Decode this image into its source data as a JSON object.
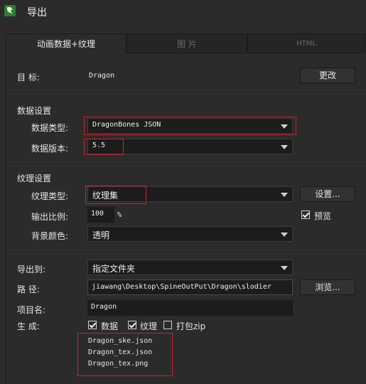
{
  "window": {
    "title": "导出"
  },
  "tabs": [
    {
      "label": "动画数据+纹理"
    },
    {
      "label": "图 片"
    },
    {
      "label": "HTML"
    }
  ],
  "target": {
    "label": "目 标:",
    "value": "Dragon",
    "change_button": "更改"
  },
  "data_settings": {
    "section_title": "数据设置",
    "type_label": "数据类型:",
    "type_value": "DragonBones JSON",
    "version_label": "数据版本:",
    "version_value": "5.5"
  },
  "texture_settings": {
    "section_title": "纹理设置",
    "type_label": "纹理类型:",
    "type_value": "纹理集",
    "settings_button": "设置...",
    "scale_label": "输出比例:",
    "scale_value": "100",
    "scale_unit": "%",
    "preview_label": "预览",
    "preview_checked": true,
    "bg_label": "背景颜色:",
    "bg_value": "透明"
  },
  "export": {
    "export_to_label": "导出到:",
    "export_to_value": "指定文件夹",
    "path_label": "路 径:",
    "path_value": "jiawang\\Desktop\\SpineOutPut\\Dragon\\slodier",
    "browse_button": "浏览...",
    "project_label": "项目名:",
    "project_value": "Dragon",
    "generate_label": "生 成:",
    "options": [
      {
        "label": "数据",
        "checked": true
      },
      {
        "label": "纹理",
        "checked": true
      },
      {
        "label": "打包zip",
        "checked": false
      }
    ],
    "files": [
      "Dragon_ske.json",
      "Dragon_tex.json",
      "Dragon_tex.png"
    ]
  },
  "colors": {
    "highlight": "#d0202a",
    "background": "#2b2b2b",
    "icon": "#2f7d32"
  }
}
